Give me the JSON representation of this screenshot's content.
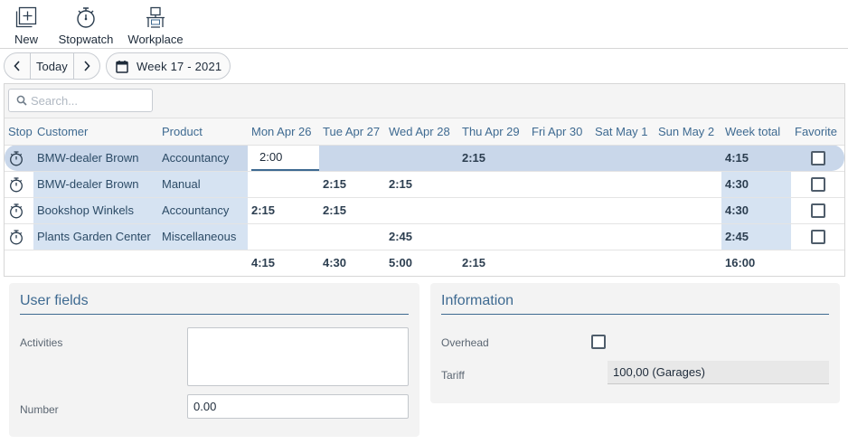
{
  "toolbar": {
    "new_label": "New",
    "stopwatch_label": "Stopwatch",
    "workplace_label": "Workplace"
  },
  "nav": {
    "today_label": "Today",
    "week_label": "Week 17 - 2021"
  },
  "search": {
    "placeholder": "Search..."
  },
  "grid": {
    "columns": {
      "stop": "Stop",
      "customer": "Customer",
      "product": "Product",
      "mon": "Mon Apr 26",
      "tue": "Tue Apr 27",
      "wed": "Wed Apr 28",
      "thu": "Thu Apr 29",
      "fri": "Fri Apr 30",
      "sat": "Sat May 1",
      "sun": "Sun May 2",
      "total": "Week total",
      "favorite": "Favorite"
    },
    "rows": [
      {
        "customer": "BMW-dealer Brown",
        "product": "Accountancy",
        "mon": "2:00",
        "tue": "",
        "wed": "",
        "thu": "2:15",
        "fri": "",
        "sat": "",
        "sun": "",
        "total": "4:15"
      },
      {
        "customer": "BMW-dealer Brown",
        "product": "Manual",
        "mon": "",
        "tue": "2:15",
        "wed": "2:15",
        "thu": "",
        "fri": "",
        "sat": "",
        "sun": "",
        "total": "4:30"
      },
      {
        "customer": "Bookshop Winkels",
        "product": "Accountancy",
        "mon": "2:15",
        "tue": "2:15",
        "wed": "",
        "thu": "",
        "fri": "",
        "sat": "",
        "sun": "",
        "total": "4:30"
      },
      {
        "customer": "Plants Garden Center",
        "product": "Miscellaneous",
        "mon": "",
        "tue": "",
        "wed": "2:45",
        "thu": "",
        "fri": "",
        "sat": "",
        "sun": "",
        "total": "2:45"
      }
    ],
    "totals": {
      "mon": "4:15",
      "tue": "4:30",
      "wed": "5:00",
      "thu": "2:15",
      "fri": "",
      "sat": "",
      "sun": "",
      "total": "16:00"
    }
  },
  "user_fields": {
    "title": "User fields",
    "activities_label": "Activities",
    "activities_value": "",
    "number_label": "Number",
    "number_value": "0.00"
  },
  "information": {
    "title": "Information",
    "overhead_label": "Overhead",
    "tariff_label": "Tariff",
    "tariff_value": "100,00 (Garages)"
  },
  "colors": {
    "accent": "#3e6a91",
    "row_highlight": "#d6e3f2",
    "row_selected": "#c9d7ea",
    "panel_bg": "#f3f3f3"
  },
  "icons": [
    "new-icon",
    "stopwatch-icon",
    "workplace-icon",
    "chevron-left-icon",
    "chevron-right-icon",
    "calendar-icon",
    "search-icon"
  ]
}
